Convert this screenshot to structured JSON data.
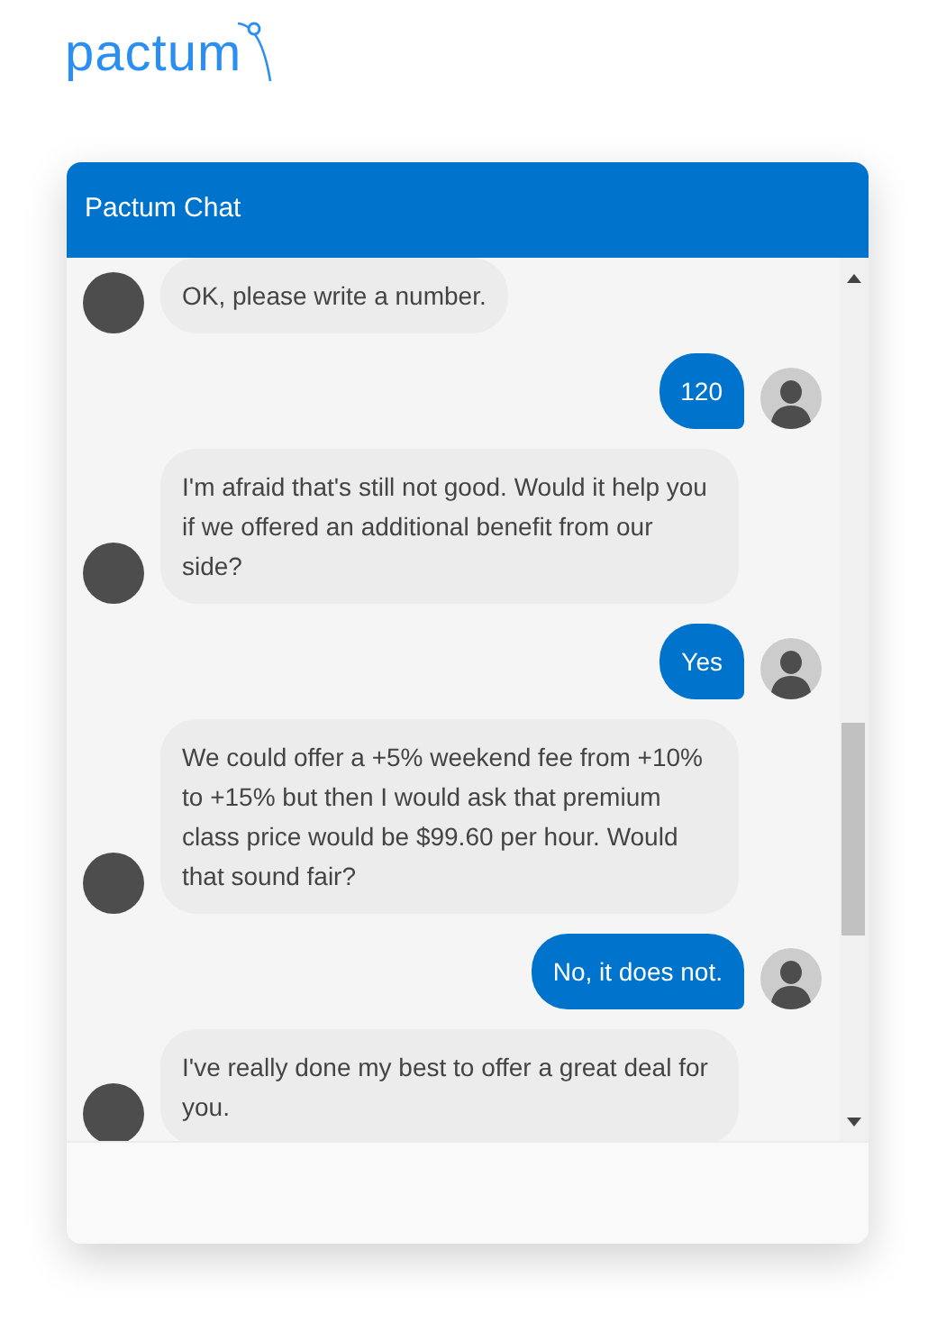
{
  "logo": {
    "text": "pactum"
  },
  "chat": {
    "title": "Pactum Chat",
    "messages": [
      {
        "kind": "bot",
        "text": "OK, please write a number."
      },
      {
        "kind": "user",
        "text": "120"
      },
      {
        "kind": "bot",
        "text": "I'm afraid that's still not good. Would it help you if we offered an additional benefit from our side?"
      },
      {
        "kind": "user",
        "text": "Yes"
      },
      {
        "kind": "bot",
        "text": "We could offer a +5% weekend fee from +10% to +15% but then I would ask that premium class price would be $99.60 per hour. Would that sound fair?"
      },
      {
        "kind": "user",
        "text": "No, it does not."
      },
      {
        "kind": "bot",
        "text": "I've really done my best to offer a great deal for you."
      }
    ]
  }
}
